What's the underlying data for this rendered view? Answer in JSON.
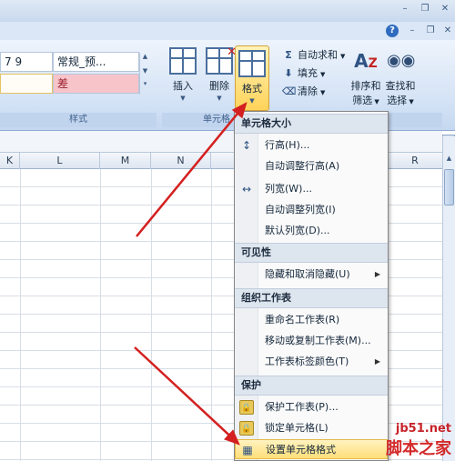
{
  "ribbon": {
    "style_cells": [
      "7 9",
      "常规_预...",
      "",
      "差"
    ],
    "group_styles_caption": "样式",
    "group_cells_caption": "单元格",
    "buttons": {
      "insert": "插入",
      "delete": "删除",
      "format": "格式",
      "sort_filter_line1": "排序和",
      "sort_filter_line2": "筛选",
      "find_select_line1": "查找和",
      "find_select_line2": "选择"
    },
    "editing": {
      "autosum": "自动求和",
      "fill": "填充",
      "clear": "清除"
    }
  },
  "columns": [
    "K",
    "L",
    "M",
    "N",
    "R"
  ],
  "menu": {
    "sections": [
      {
        "header": "单元格大小",
        "items": [
          {
            "label": "行高(H)..."
          },
          {
            "label": "自动调整行高(A)"
          },
          {
            "label": "列宽(W)..."
          },
          {
            "label": "自动调整列宽(I)"
          },
          {
            "label": "默认列宽(D)..."
          }
        ]
      },
      {
        "header": "可见性",
        "items": [
          {
            "label": "隐藏和取消隐藏(U)"
          }
        ]
      },
      {
        "header": "组织工作表",
        "items": [
          {
            "label": "重命名工作表(R)"
          },
          {
            "label": "移动或复制工作表(M)..."
          },
          {
            "label": "工作表标签颜色(T)"
          }
        ]
      },
      {
        "header": "保护",
        "items": [
          {
            "label": "保护工作表(P)..."
          },
          {
            "label": "锁定单元格(L)"
          },
          {
            "label": "设置单元格格式"
          }
        ]
      }
    ]
  },
  "watermark": {
    "url": "jb51.net",
    "name": "脚本之家"
  },
  "colors": {
    "arrow": "#d42020",
    "ribbon_bg": "#d3e2f5",
    "highlight": "#ffdf7a"
  }
}
